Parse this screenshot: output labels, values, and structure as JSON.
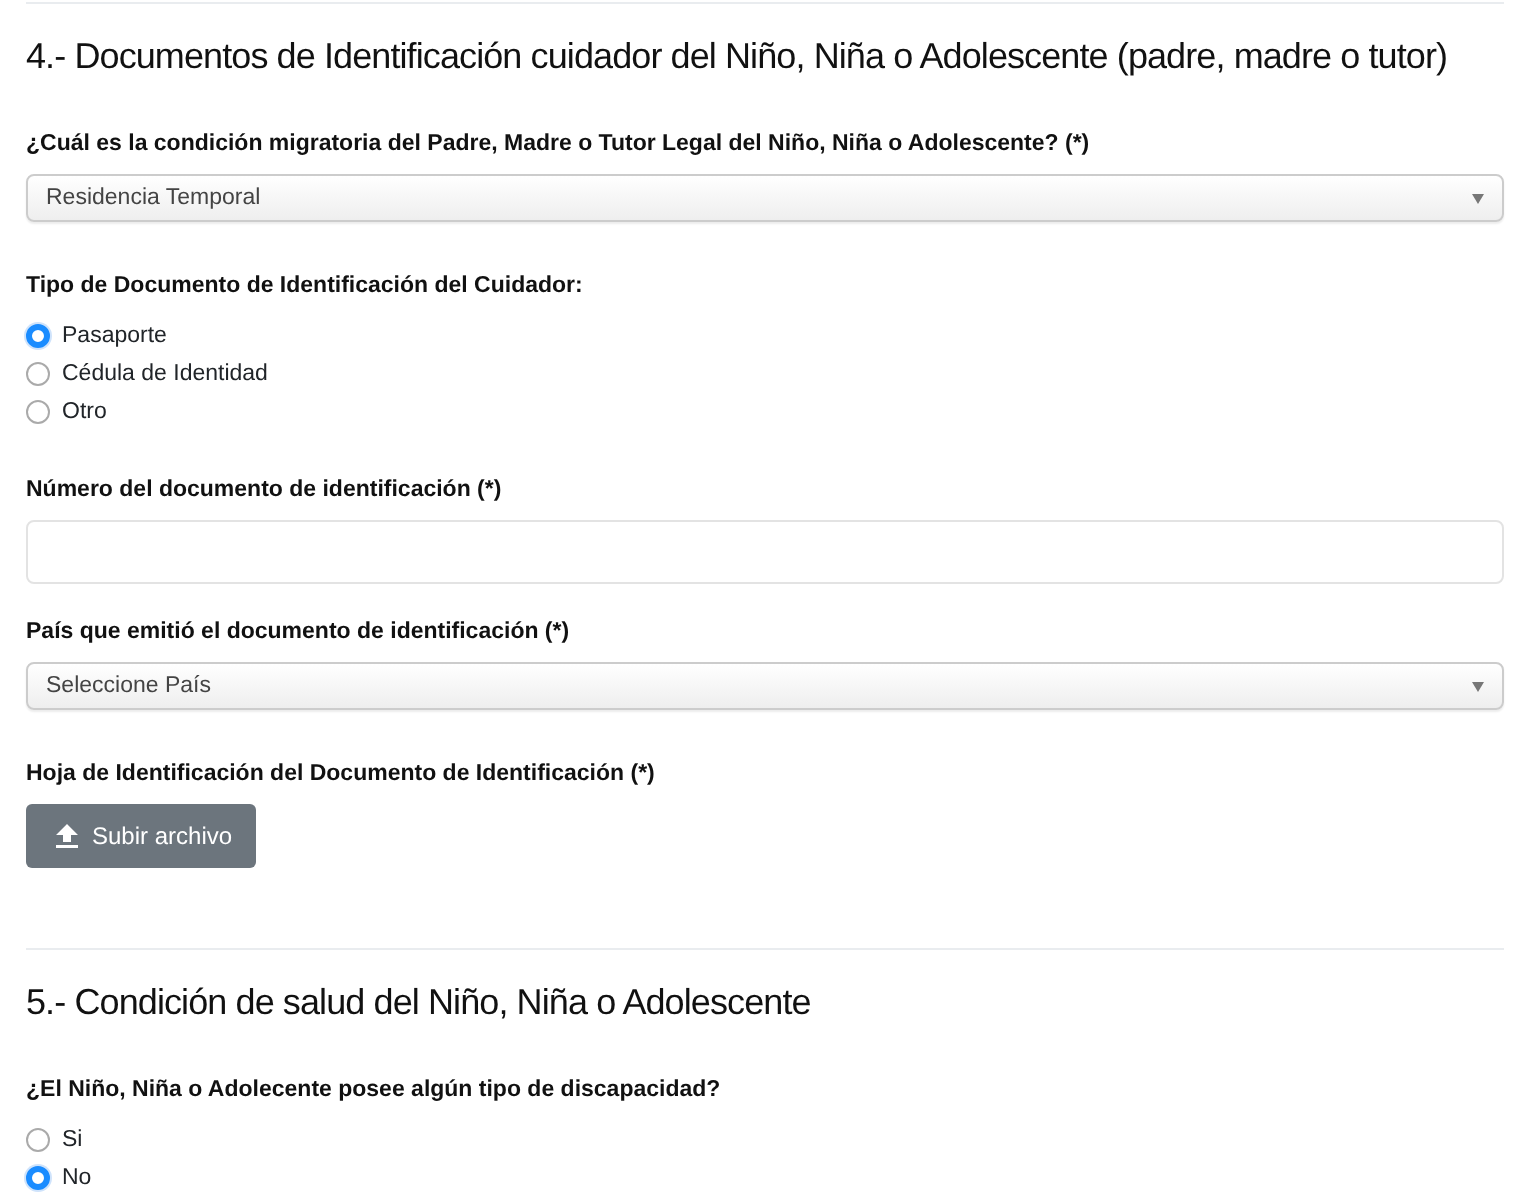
{
  "sections": [
    {
      "title": "4.- Documentos de Identificación cuidador del Niño, Niña o Adolescente (padre, madre o tutor)",
      "fields": [
        {
          "kind": "select",
          "label": "¿Cuál es la condición migratoria del Padre, Madre o Tutor Legal del Niño, Niña o Adolescente? (*)",
          "value": "Residencia Temporal"
        },
        {
          "kind": "radio",
          "label": "Tipo de Documento de Identificación del Cuidador:",
          "options": [
            {
              "label": "Pasaporte",
              "selected": true
            },
            {
              "label": "Cédula de Identidad",
              "selected": false
            },
            {
              "label": "Otro",
              "selected": false
            }
          ]
        },
        {
          "kind": "text",
          "label": "Número del documento de identificación (*)"
        },
        {
          "kind": "select",
          "label": "País que emitió el documento de identificación (*)",
          "value": "Seleccione País"
        },
        {
          "kind": "upload",
          "label": "Hoja de Identificación del Documento de Identificación (*)",
          "button": "Subir archivo"
        }
      ]
    },
    {
      "title": "5.- Condición de salud del Niño, Niña o Adolescente",
      "fields": [
        {
          "kind": "radio",
          "label": "¿El Niño, Niña o Adolecente posee algún tipo de discapacidad?",
          "options": [
            {
              "label": "Si",
              "selected": false
            },
            {
              "label": "No",
              "selected": true
            }
          ]
        }
      ]
    }
  ]
}
